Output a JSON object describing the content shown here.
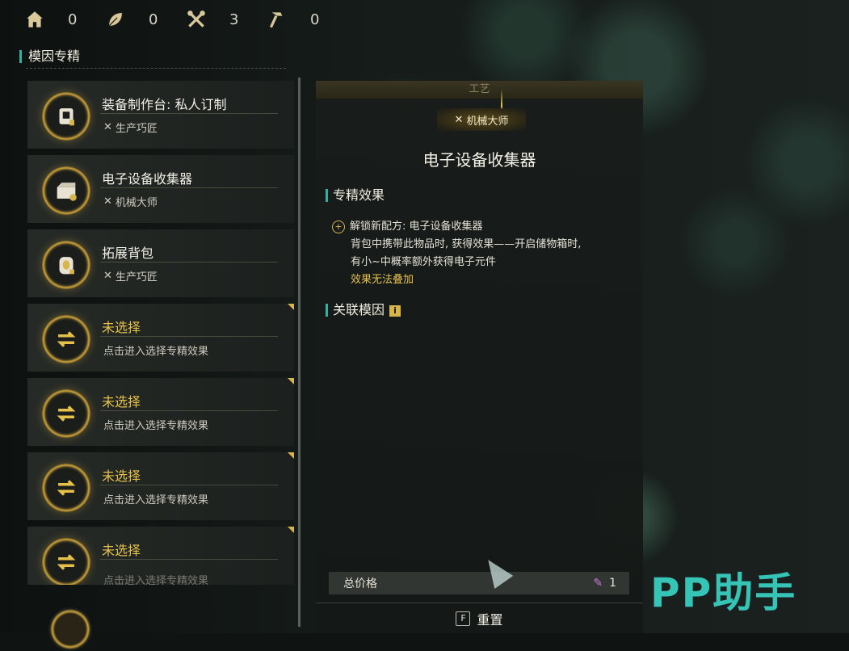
{
  "resources": [
    {
      "icon": "house-icon",
      "value": "0"
    },
    {
      "icon": "leaf-icon",
      "value": "0"
    },
    {
      "icon": "crossed-tools-icon",
      "value": "3"
    },
    {
      "icon": "hammer-icon",
      "value": "0"
    }
  ],
  "left_panel": {
    "title": "模因专精",
    "cards": [
      {
        "name": "装备制作台: 私人订制",
        "sub": "生产巧匠",
        "selected": true
      },
      {
        "name": "电子设备收集器",
        "sub": "机械大师",
        "selected": true
      },
      {
        "name": "拓展背包",
        "sub": "生产巧匠",
        "selected": true
      },
      {
        "name": "未选择",
        "sub": "点击进入选择专精效果",
        "selected": false
      },
      {
        "name": "未选择",
        "sub": "点击进入选择专精效果",
        "selected": false
      },
      {
        "name": "未选择",
        "sub": "点击进入选择专精效果",
        "selected": false
      },
      {
        "name": "未选择",
        "sub": "点击进入选择专精效果",
        "selected": false
      }
    ]
  },
  "detail": {
    "category_bar": "工艺",
    "badge": "机械大师",
    "title": "电子设备收集器",
    "effects_header": "专精效果",
    "effect_line1": "解锁新配方: 电子设备收集器",
    "effect_line2": "背包中携带此物品时, 获得效果——开启储物箱时,",
    "effect_line3": "有小~中概率额外获得电子元件",
    "effect_note": "效果无法叠加",
    "related_header": "关联模因",
    "price_label": "总价格",
    "price_value": "1",
    "reset_key": "F",
    "reset_label": "重置"
  },
  "watermark": "PP助手"
}
